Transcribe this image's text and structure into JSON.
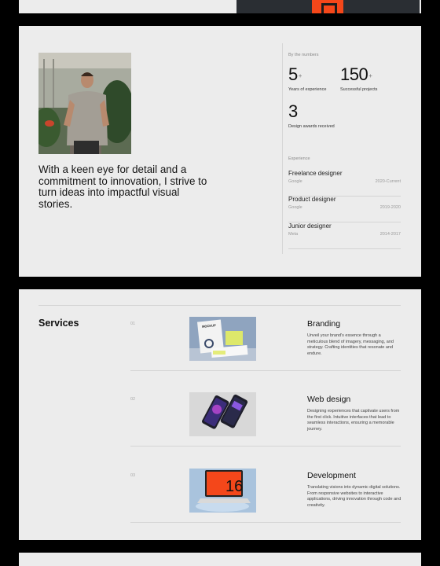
{
  "about": {
    "bio": "With a keen eye for detail and a commitment to innovation, I strive to turn ideas into impactful visual stories.",
    "stats_label": "By the numbers",
    "stats": [
      {
        "value": "5",
        "suffix": "+",
        "caption": "Years of experience"
      },
      {
        "value": "150",
        "suffix": "+",
        "caption": "Successful projects"
      },
      {
        "value": "3",
        "suffix": "",
        "caption": "Design awards received"
      }
    ],
    "experience_label": "Experience",
    "experience": [
      {
        "role": "Freelance designer",
        "company": "Google",
        "period": "2020-Current"
      },
      {
        "role": "Product designer",
        "company": "Google",
        "period": "2019-2020"
      },
      {
        "role": "Junior designer",
        "company": "Meta",
        "period": "2014-2017"
      }
    ]
  },
  "services": {
    "title": "Services",
    "items": [
      {
        "index": "01",
        "name": "Branding",
        "description": "Unveil your brand's essence through a meticulous blend of imagery, messaging, and strategy. Crafting identities that resonate and endure.",
        "thumb_text": "MOCKUP"
      },
      {
        "index": "02",
        "name": "Web design",
        "description": "Designing experiences that captivate users from the first click. Intuitive interfaces that lead to seamless interactions, ensuring a memorable journey."
      },
      {
        "index": "03",
        "name": "Development",
        "description": "Translating visions into dynamic digital solutions. From responsive websites to interactive applications, driving innovation through code and creativity.",
        "thumb_text": "16"
      }
    ]
  },
  "colors": {
    "panel": "#ececec",
    "background": "#000000",
    "accent": "#f4471a",
    "divider": "#d4d4d4"
  }
}
